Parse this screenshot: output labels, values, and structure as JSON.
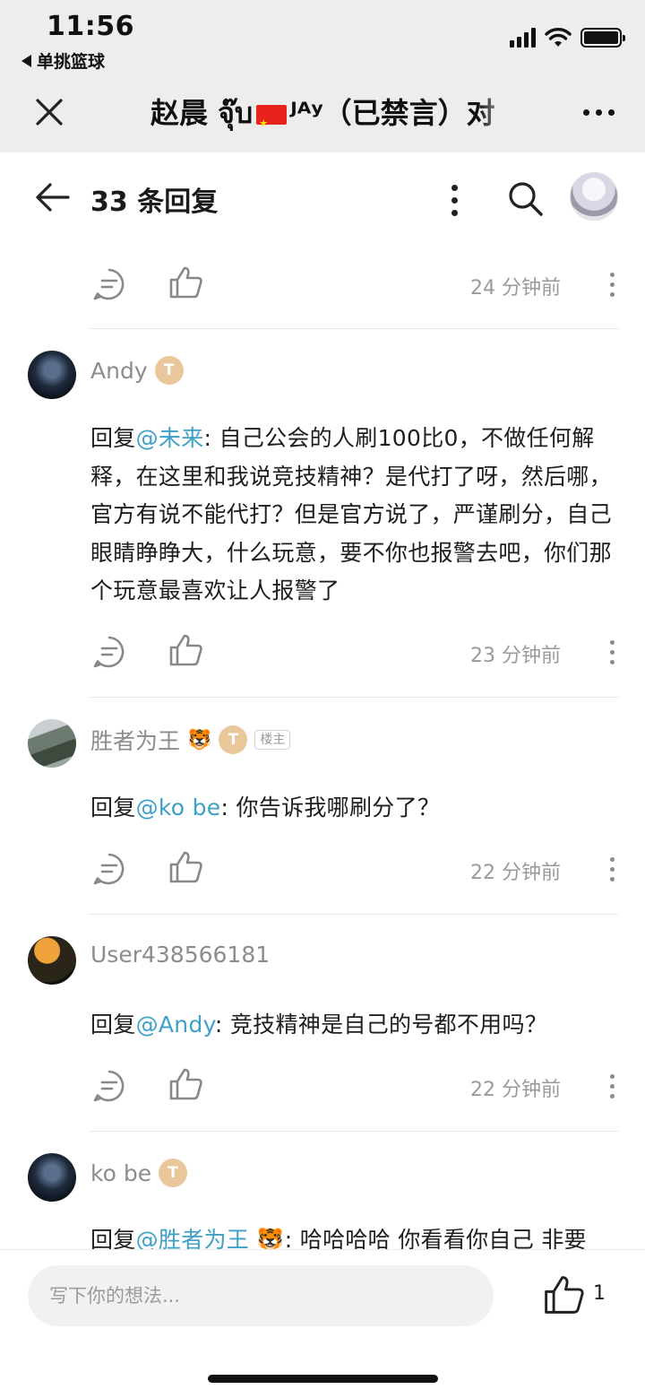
{
  "status_bar": {
    "time": "11:56",
    "back_app_label": "单挑篮球"
  },
  "header": {
    "title_part1": "赵晨 จุ๊บ",
    "title_part2": "ᴶᴬʸ（已禁言）对"
  },
  "reply_header": {
    "title": "33 条回复"
  },
  "first_actions": {
    "time": "24 分钟前"
  },
  "comments": [
    {
      "name": "Andy",
      "badge": "T",
      "mention": "@未来",
      "reply_prefix": "回复",
      "text": ": 自己公会的人刷100比0，不做任何解释，在这里和我说竞技精神？是代打了呀，然后哪，官方有说不能代打？但是官方说了，严谨刷分，自己眼睛睁睁大，什么玩意，要不你也报警去吧，你们那个玩意最喜欢让人报警了",
      "time": "23 分钟前"
    },
    {
      "name": "胜者为王",
      "emoji": "🐯",
      "badge": "T",
      "host_label": "楼主",
      "reply_prefix": "回复",
      "mention": "@ko be",
      "text": ": 你告诉我哪刷分了？",
      "time": "22 分钟前"
    },
    {
      "name": "User438566181",
      "reply_prefix": "回复",
      "mention": "@Andy",
      "text": ": 竞技精神是自己的号都不用吗？",
      "time": "22 分钟前"
    },
    {
      "name": "ko be",
      "badge": "T",
      "reply_prefix": "回复",
      "mention": "@胜者为王 🐯",
      "text": ": 哈哈哈哈 你看看你自己 非要"
    }
  ],
  "bottom": {
    "placeholder": "写下你的想法...",
    "like_count": "1"
  },
  "icons": [
    "close-icon",
    "back-arrow-icon",
    "search-icon",
    "comment-icon",
    "like-icon",
    "more-icon",
    "signal-icon",
    "wifi-icon",
    "battery-icon"
  ]
}
